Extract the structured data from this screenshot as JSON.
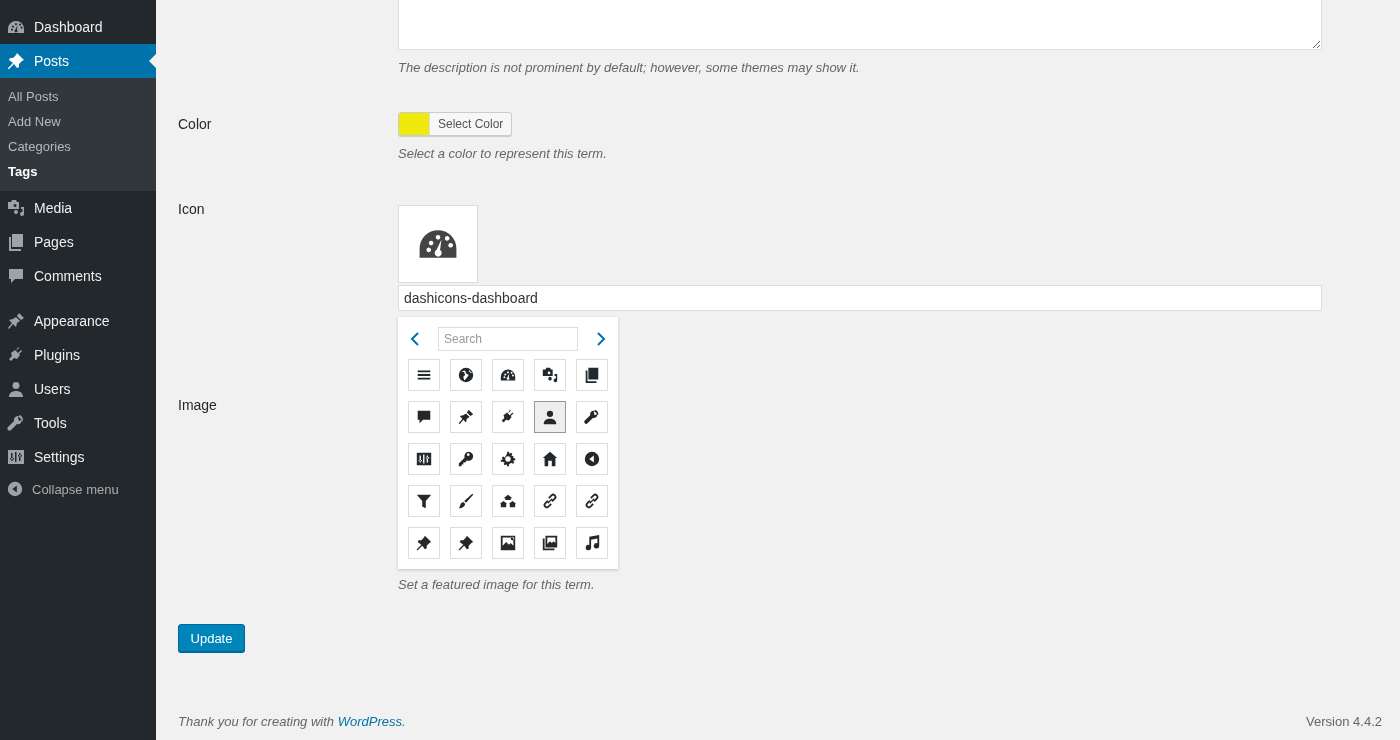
{
  "sidebar": {
    "groups": [
      {
        "items": [
          {
            "label": "Dashboard",
            "kind": "dashboard",
            "selected": false
          },
          {
            "label": "Posts",
            "kind": "posts",
            "selected": true,
            "children": [
              {
                "label": "All Posts",
                "selected": false
              },
              {
                "label": "Add New",
                "selected": false
              },
              {
                "label": "Categories",
                "selected": false
              },
              {
                "label": "Tags",
                "selected": true
              }
            ]
          },
          {
            "label": "Media",
            "kind": "media",
            "selected": false
          },
          {
            "label": "Pages",
            "kind": "pages",
            "selected": false
          },
          {
            "label": "Comments",
            "kind": "comments",
            "selected": false
          }
        ]
      },
      {
        "items": [
          {
            "label": "Appearance",
            "kind": "appearance",
            "selected": false
          },
          {
            "label": "Plugins",
            "kind": "plugins",
            "selected": false
          },
          {
            "label": "Users",
            "kind": "users",
            "selected": false
          },
          {
            "label": "Tools",
            "kind": "tools",
            "selected": false
          },
          {
            "label": "Settings",
            "kind": "settings",
            "selected": false
          }
        ]
      }
    ],
    "collapse": {
      "label": "Collapse menu"
    }
  },
  "form": {
    "description": {
      "hint": "The description is not prominent by default; however, some themes may show it."
    },
    "color_field": {
      "label": "Color",
      "color": "#efe90e",
      "button": "Select Color",
      "hint": "Select a color to represent this term."
    },
    "icon": {
      "label": "Icon",
      "value": "dashicons-dashboard",
      "picker": {
        "placeholder": "Search",
        "icons": [
          {
            "kind": "menu",
            "selected": false
          },
          {
            "kind": "globe",
            "selected": false
          },
          {
            "kind": "dashboard",
            "selected": false
          },
          {
            "kind": "media",
            "selected": false
          },
          {
            "kind": "pages",
            "selected": false
          },
          {
            "kind": "comments",
            "selected": false
          },
          {
            "kind": "appearance",
            "selected": false
          },
          {
            "kind": "plugins",
            "selected": false
          },
          {
            "kind": "users",
            "selected": true
          },
          {
            "kind": "tools",
            "selected": false
          },
          {
            "kind": "settings",
            "selected": false
          },
          {
            "kind": "key",
            "selected": false
          },
          {
            "kind": "gear",
            "selected": false
          },
          {
            "kind": "home",
            "selected": false
          },
          {
            "kind": "collapse",
            "selected": false
          },
          {
            "kind": "filter",
            "selected": false
          },
          {
            "kind": "brush",
            "selected": false
          },
          {
            "kind": "network",
            "selected": false
          },
          {
            "kind": "link",
            "selected": false
          },
          {
            "kind": "link",
            "selected": false
          },
          {
            "kind": "posts",
            "selected": false
          },
          {
            "kind": "posts",
            "selected": false
          },
          {
            "kind": "image",
            "selected": false
          },
          {
            "kind": "gallery",
            "selected": false
          },
          {
            "kind": "music",
            "selected": false
          }
        ]
      }
    },
    "image": {
      "label": "Image",
      "hint": "Set a featured image for this term."
    },
    "submit": "Update"
  },
  "footer": {
    "thanks": "Thank you for creating with ",
    "link": "WordPress",
    "end": ".",
    "version": "Version 4.4.2"
  }
}
